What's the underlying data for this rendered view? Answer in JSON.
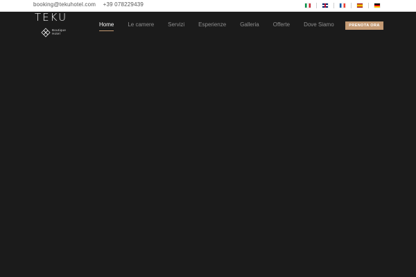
{
  "topbar": {
    "email": "booking@tekuhotel.com",
    "phone": "+39 078229439",
    "languages": [
      "it",
      "en",
      "fr",
      "es",
      "de"
    ]
  },
  "brand": {
    "name": "TEKU",
    "tagline_line1": "Boutique",
    "tagline_line2": "Hotel"
  },
  "nav": {
    "items": [
      {
        "label": "Home",
        "active": true
      },
      {
        "label": "Le camere",
        "active": false
      },
      {
        "label": "Servizi",
        "active": false
      },
      {
        "label": "Esperienze",
        "active": false
      },
      {
        "label": "Galleria",
        "active": false
      },
      {
        "label": "Offerte",
        "active": false
      },
      {
        "label": "Dove Siamo",
        "active": false
      }
    ]
  },
  "cta": {
    "label": "PRENOTA ORA"
  },
  "colors": {
    "background": "#1b1b1b",
    "accent": "#c49a74",
    "topbar": "#ffffff"
  }
}
